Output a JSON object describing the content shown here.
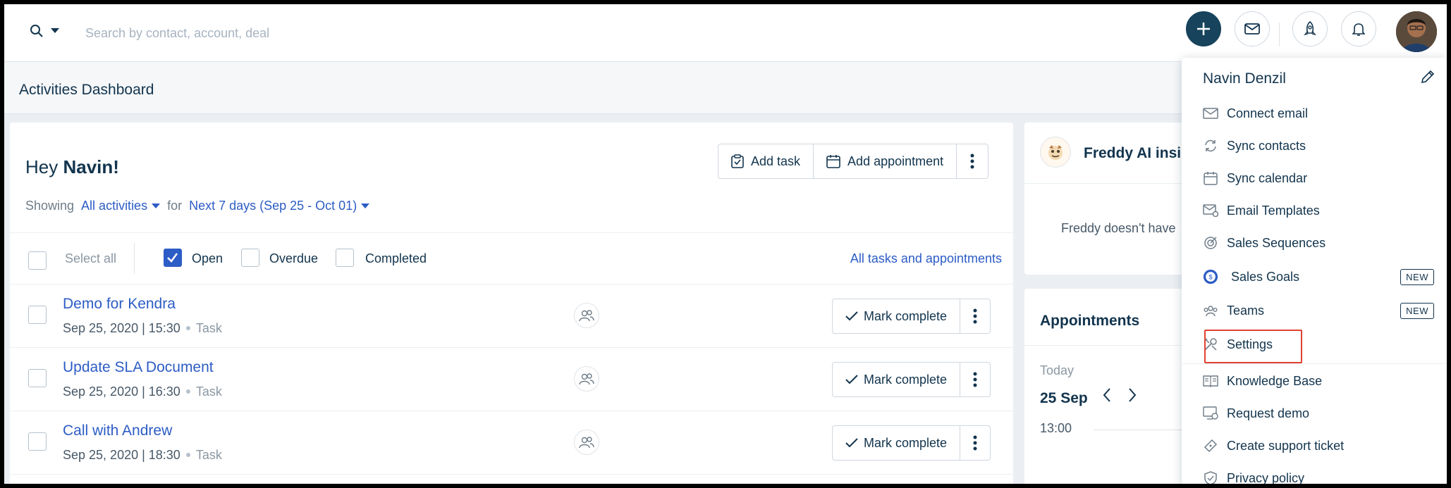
{
  "topbar": {
    "search_placeholder": "Search by contact, account, deal"
  },
  "page": {
    "title": "Activities Dashboard"
  },
  "greeting": {
    "prefix": "Hey",
    "name": "Navin!"
  },
  "actions": {
    "add_task": "Add task",
    "add_appointment": "Add appointment"
  },
  "showing": {
    "label": "Showing",
    "activities": "All activities",
    "for_label": "for",
    "range": "Next 7 days (Sep 25 - Oct 01)"
  },
  "filters": {
    "select_all": "Select all",
    "open": "Open",
    "overdue": "Overdue",
    "completed": "Completed",
    "all_link": "All tasks and appointments"
  },
  "tasks": [
    {
      "title": "Demo for Kendra",
      "datetime": "Sep 25, 2020 | 15:30",
      "type": "Task",
      "action": "Mark complete"
    },
    {
      "title": "Update SLA Document",
      "datetime": "Sep 25, 2020 | 16:30",
      "type": "Task",
      "action": "Mark complete"
    },
    {
      "title": "Call with Andrew",
      "datetime": "Sep 25, 2020 | 18:30",
      "type": "Task",
      "action": "Mark complete"
    }
  ],
  "freddy": {
    "title": "Freddy AI insig",
    "message": "Freddy doesn't have"
  },
  "appointments": {
    "title": "Appointments",
    "today": "Today",
    "date": "25 Sep",
    "time": "13:00"
  },
  "dropdown": {
    "name": "Navin Denzil",
    "items": [
      {
        "label": "Connect email",
        "icon": "mail-icon"
      },
      {
        "label": "Sync contacts",
        "icon": "sync-icon"
      },
      {
        "label": "Sync calendar",
        "icon": "calendar-icon"
      },
      {
        "label": "Email Templates",
        "icon": "template-icon"
      },
      {
        "label": "Sales Sequences",
        "icon": "target-icon"
      },
      {
        "label": "Sales Goals",
        "icon": "goal-icon",
        "badge": "NEW"
      },
      {
        "label": "Teams",
        "icon": "teams-icon",
        "badge": "NEW"
      },
      {
        "label": "Settings",
        "icon": "settings-icon"
      },
      {
        "label": "Knowledge Base",
        "icon": "book-icon"
      },
      {
        "label": "Request demo",
        "icon": "demo-icon"
      },
      {
        "label": "Create support ticket",
        "icon": "ticket-icon"
      },
      {
        "label": "Privacy policy",
        "icon": "shield-icon"
      }
    ]
  },
  "colors": {
    "primary": "#17435c",
    "link": "#2c5cc5",
    "highlight": "#e0412f"
  }
}
